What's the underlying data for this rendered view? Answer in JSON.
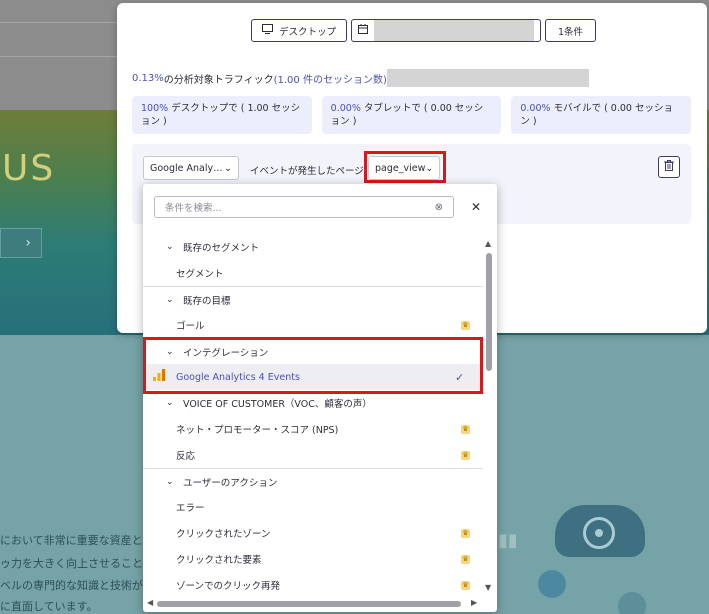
{
  "toolbar": {
    "device_label": "デスクトップ",
    "conditions_label": "1条件"
  },
  "traffic": {
    "percent": "0.13%",
    "text": "の分析対象トラフィック",
    "sessions": "(1.00 件のセッション数)"
  },
  "cards": [
    {
      "value": "100%",
      "text": "デスクトップで ( 1.00 セッション )"
    },
    {
      "value": "0.00%",
      "text": "タブレットで ( 0.00 セッション )"
    },
    {
      "value": "0.00%",
      "text": "モバイルで ( 0.00 セッション )"
    }
  ],
  "filter": {
    "source_select": "Google Analy…",
    "event_label": "イベントが発生したページ",
    "event_select": "page_view"
  },
  "dropdown": {
    "search_placeholder": "条件を検索...",
    "groups": {
      "existing_segments": "既存のセグメント",
      "segment_item": "セグメント",
      "existing_goals": "既存の目標",
      "goal_item": "ゴール",
      "integrations": "インテグレーション",
      "ga4_item": "Google Analytics 4 Events",
      "voc": "VOICE OF CUSTOMER（VOC、顧客の声）",
      "nps_item": "ネット・プロモーター・スコア (NPS)",
      "reaction_item": "反応",
      "user_actions": "ユーザーのアクション",
      "error_item": "エラー",
      "clicked_zone_item": "クリックされたゾーン",
      "clicked_element_item": "クリックされた要素",
      "zone_click_replay_item": "ゾーンでのクリック再発"
    }
  },
  "background": {
    "hero_text": "US",
    "lines": [
      "において非常に重要な資産とな",
      "ゥ力を大きく向上させることが",
      "ベルの専門的な知識と技術が",
      "に直面しています。"
    ]
  },
  "colors": {
    "accent": "#4a4fc4",
    "highlight": "#d7191c",
    "card_bg": "#eceefb",
    "premium_badge": "#f5d77c"
  }
}
